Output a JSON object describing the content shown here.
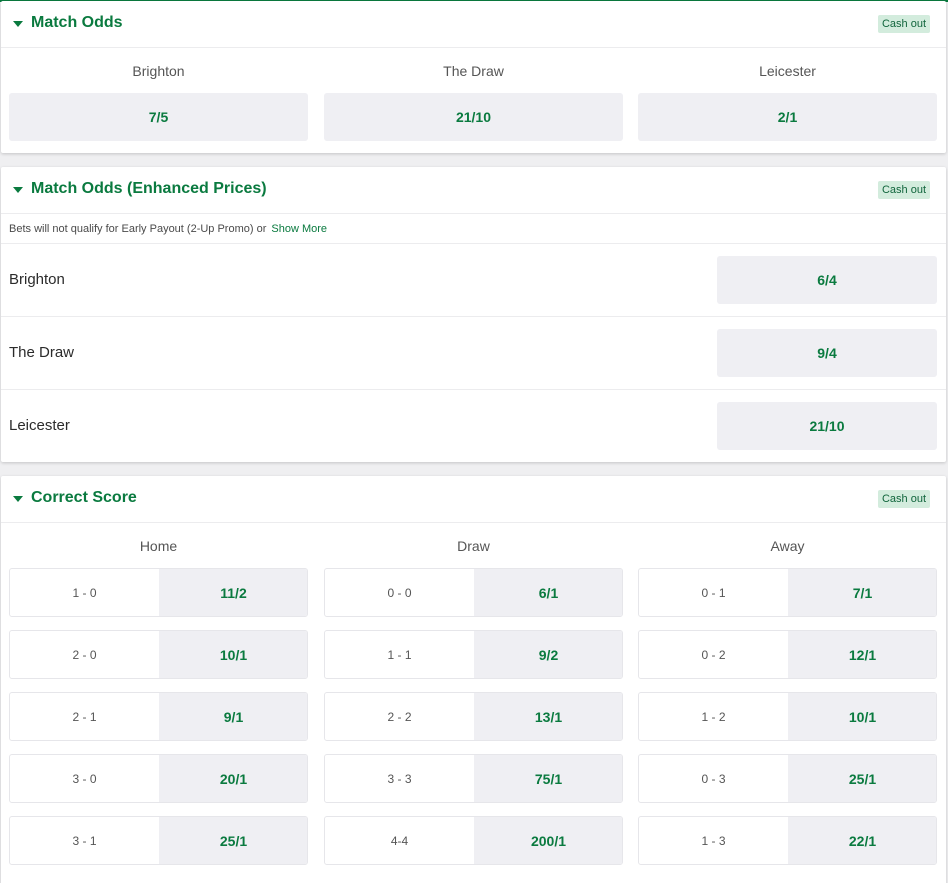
{
  "colors": {
    "brand_green": "#0a7a3f",
    "cash_out_bg": "#d3ecdd",
    "price_bg": "#efeff3"
  },
  "match_odds": {
    "title": "Match Odds",
    "cash_out": "Cash out",
    "columns": [
      "Brighton",
      "The Draw",
      "Leicester"
    ],
    "prices": [
      "7/5",
      "21/10",
      "2/1"
    ]
  },
  "enhanced": {
    "title": "Match Odds (Enhanced Prices)",
    "cash_out": "Cash out",
    "promo_text": "Bets will not qualify for Early Payout (2-Up Promo) or",
    "promo_link": "Show More",
    "rows": [
      {
        "name": "Brighton",
        "price": "6/4"
      },
      {
        "name": "The Draw",
        "price": "9/4"
      },
      {
        "name": "Leicester",
        "price": "21/10"
      }
    ]
  },
  "correct_score": {
    "title": "Correct Score",
    "cash_out": "Cash out",
    "columns": [
      {
        "label": "Home",
        "rows": [
          {
            "score": "1 - 0",
            "price": "11/2"
          },
          {
            "score": "2 - 0",
            "price": "10/1"
          },
          {
            "score": "2 - 1",
            "price": "9/1"
          },
          {
            "score": "3 - 0",
            "price": "20/1"
          },
          {
            "score": "3 - 1",
            "price": "25/1"
          }
        ]
      },
      {
        "label": "Draw",
        "rows": [
          {
            "score": "0 - 0",
            "price": "6/1"
          },
          {
            "score": "1 - 1",
            "price": "9/2"
          },
          {
            "score": "2 - 2",
            "price": "13/1"
          },
          {
            "score": "3 - 3",
            "price": "75/1"
          },
          {
            "score": "4-4",
            "price": "200/1"
          }
        ]
      },
      {
        "label": "Away",
        "rows": [
          {
            "score": "0 - 1",
            "price": "7/1"
          },
          {
            "score": "0 - 2",
            "price": "12/1"
          },
          {
            "score": "1 - 2",
            "price": "10/1"
          },
          {
            "score": "0 - 3",
            "price": "25/1"
          },
          {
            "score": "1 - 3",
            "price": "22/1"
          }
        ]
      }
    ]
  }
}
